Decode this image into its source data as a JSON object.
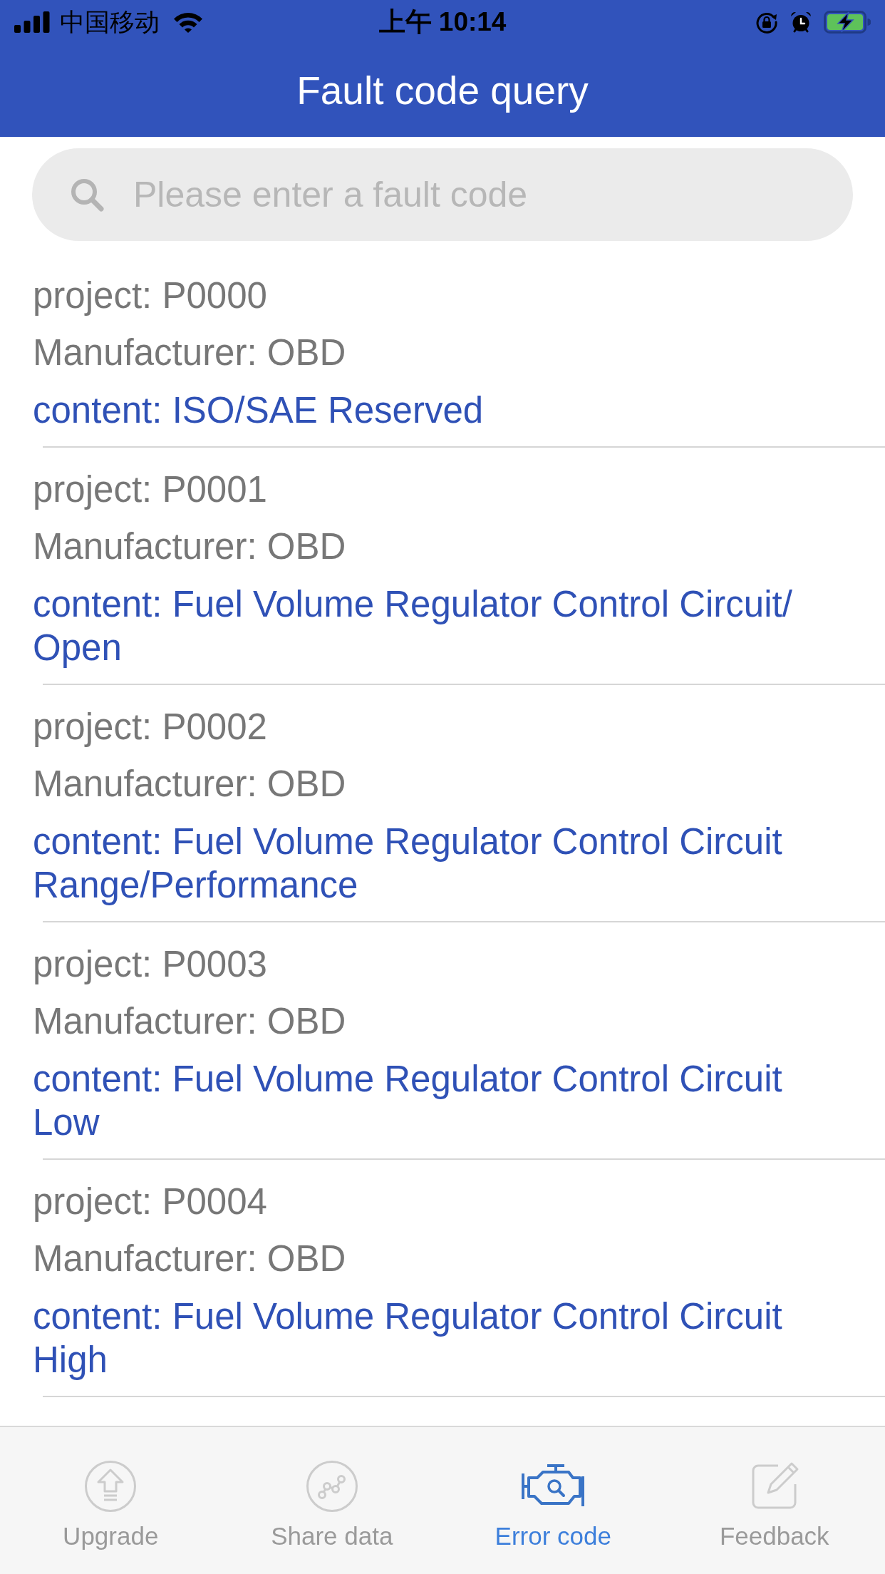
{
  "status_bar": {
    "carrier": "中国移动",
    "time": "上午 10:14"
  },
  "header": {
    "title": "Fault code query"
  },
  "search": {
    "placeholder": "Please enter a fault code"
  },
  "results": [
    {
      "project": "project: P0000",
      "manufacturer": "Manufacturer: OBD",
      "content": "content: ISO/SAE Reserved"
    },
    {
      "project": "project: P0001",
      "manufacturer": "Manufacturer: OBD",
      "content": "content: Fuel Volume Regulator Control Circuit/Open"
    },
    {
      "project": "project: P0002",
      "manufacturer": "Manufacturer: OBD",
      "content": "content: Fuel Volume Regulator Control Circuit Range/Performance"
    },
    {
      "project": "project: P0003",
      "manufacturer": "Manufacturer: OBD",
      "content": "content: Fuel Volume Regulator Control Circuit Low"
    },
    {
      "project": "project: P0004",
      "manufacturer": "Manufacturer: OBD",
      "content": "content: Fuel Volume Regulator Control Circuit High"
    }
  ],
  "tab_bar": [
    {
      "label": "Upgrade",
      "selected": false
    },
    {
      "label": "Share data",
      "selected": false
    },
    {
      "label": "Error code",
      "selected": true
    },
    {
      "label": "Feedback",
      "selected": false
    }
  ]
}
